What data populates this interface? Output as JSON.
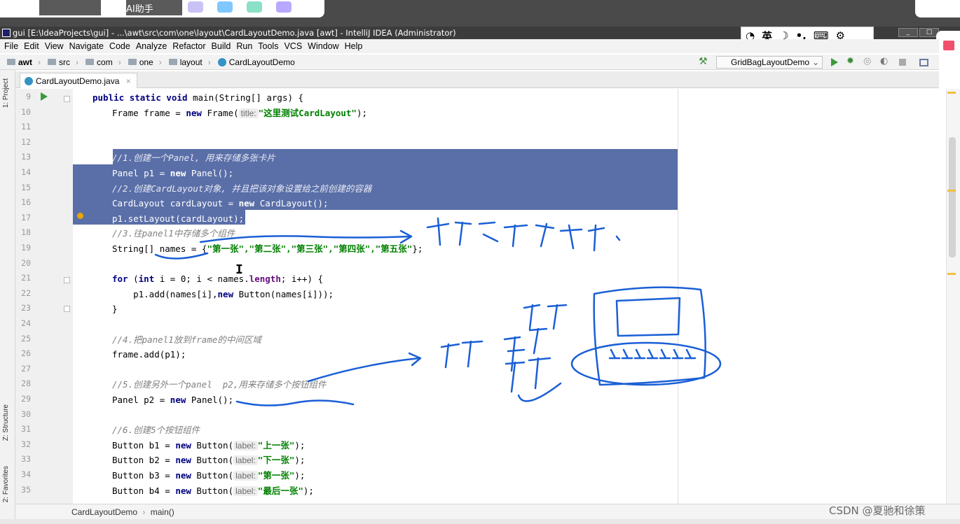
{
  "window": {
    "title": "gui [E:\\IdeaProjects\\gui] - ...\\awt\\src\\com\\one\\layout\\CardLayoutDemo.java [awt] - IntelliJ IDEA (Administrator)"
  },
  "browser_strip": {
    "ai_label": "AI助手"
  },
  "ime_toolbar": {
    "lang": "英"
  },
  "menu": [
    "File",
    "Edit",
    "View",
    "Navigate",
    "Code",
    "Analyze",
    "Refactor",
    "Build",
    "Run",
    "Tools",
    "VCS",
    "Window",
    "Help"
  ],
  "breadcrumbs": [
    "awt",
    "src",
    "com",
    "one",
    "layout",
    "CardLayoutDemo"
  ],
  "run_config": "GridBagLayoutDemo",
  "editor_tab": "CardLayoutDemo.java",
  "tool_windows": {
    "project": "1: Project",
    "structure": "Z: Structure",
    "favorites": "2: Favorites"
  },
  "line_numbers": [
    "9",
    "10",
    "11",
    "12",
    "13",
    "14",
    "15",
    "16",
    "17",
    "18",
    "19",
    "20",
    "21",
    "22",
    "23",
    "24",
    "25",
    "26",
    "27",
    "28",
    "29",
    "30",
    "31",
    "32",
    "33",
    "34",
    "35"
  ],
  "code": {
    "l9": {
      "kw1": "public",
      "kw2": "static",
      "kw3": "void",
      "rest": " main(String[] args) {"
    },
    "l10": {
      "pre": "Frame frame = ",
      "kw": "new",
      "mid": " Frame(",
      "hint": "title:",
      "str": "\"这里测试CardLayout\"",
      "post": ");"
    },
    "l13": "//1.创建一个Panel, 用来存储多张卡片",
    "l14": {
      "pre": "Panel p1 = ",
      "kw": "new",
      "post": " Panel();"
    },
    "l15": "//2.创建CardLayout对象, 并且把该对象设置给之前创建的容器",
    "l16": {
      "pre": "CardLayout cardLayout = ",
      "kw": "new",
      "post": " CardLayout();"
    },
    "l17": "p1.setLayout(cardLayout);",
    "l18": "//3.往panel1中存储多个组件",
    "l19": {
      "pre": "String[] names = {",
      "strs": "\"第一张\",\"第二张\",\"第三张\",\"第四张\",\"第五张\"",
      "post": "};"
    },
    "l21": {
      "kw": "for",
      "a": " (",
      "kw2": "int",
      "b": " i = 0; i < names.",
      "fld": "length",
      "c": "; i++) {"
    },
    "l22": {
      "pre": "    p1.add(names[i],",
      "kw": "new",
      "post": " Button(names[i]));"
    },
    "l23": "}",
    "l25": "//4.把panel1放到frame的中间区域",
    "l26": "frame.add(p1);",
    "l28": "//5.创建另外一个panel  p2,用来存储多个按钮组件",
    "l29": {
      "pre": "Panel p2 = ",
      "kw": "new",
      "post": " Panel();"
    },
    "l31": "//6.创建5个按钮组件",
    "l32": {
      "pre": "Button b1 = ",
      "kw": "new",
      "mid": " Button(",
      "hint": "label:",
      "str": "\"上一张\"",
      "post": ");"
    },
    "l33": {
      "pre": "Button b2 = ",
      "kw": "new",
      "mid": " Button(",
      "hint": "label:",
      "str": "\"下一张\"",
      "post": ");"
    },
    "l34": {
      "pre": "Button b3 = ",
      "kw": "new",
      "mid": " Button(",
      "hint": "label:",
      "str": "\"第一张\"",
      "post": ");"
    },
    "l35": {
      "pre": "Button b4 = ",
      "kw": "new",
      "mid": " Button(",
      "hint": "label:",
      "str": "\"最后一张\"",
      "post": ");"
    }
  },
  "footer_breadcrumb": [
    "CardLayoutDemo",
    "main()"
  ],
  "watermark": "CSDN @夏驰和徐策",
  "colors": {
    "selection": "#5a6fa8",
    "keyword": "#000080",
    "string": "#008000",
    "comment": "#808080",
    "annotation_ink": "#1a5fd6"
  }
}
